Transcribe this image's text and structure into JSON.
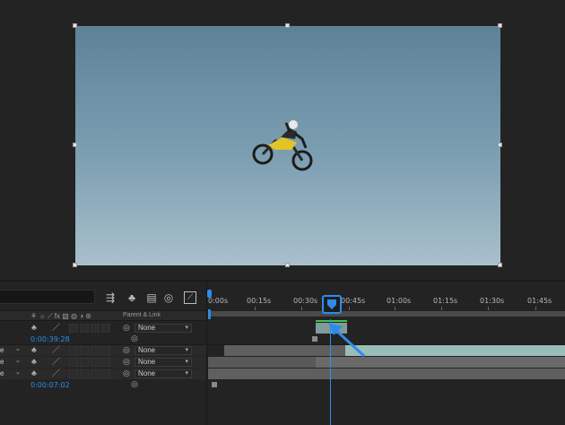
{
  "timeline": {
    "ruler_labels": [
      "0:00s",
      "00:15s",
      "00:30s",
      "00:45s",
      "01:00s",
      "01:15s",
      "01:30s",
      "01:45s"
    ],
    "column_header": {
      "parent_link": "Parent & Link"
    },
    "rows": [
      {
        "parent": "None"
      },
      {
        "timecode": "0:00:39:28"
      },
      {
        "stub": "e",
        "parent": "None"
      },
      {
        "stub": "e",
        "parent": "None"
      },
      {
        "stub": "e",
        "parent": "None"
      },
      {
        "timecode": "0:00:07:02"
      }
    ]
  },
  "colors": {
    "accent": "#2d8ceb",
    "green_bar": "#3fc24a",
    "track_teal": "#9bbdb7",
    "track_gray": "#5f5f5f"
  },
  "icons": [
    "shy-icon",
    "solo-icon",
    "pencil-icon",
    "motion-blur-icon",
    "graph-editor-icon",
    "parent-link-icon",
    "playhead-icon"
  ]
}
